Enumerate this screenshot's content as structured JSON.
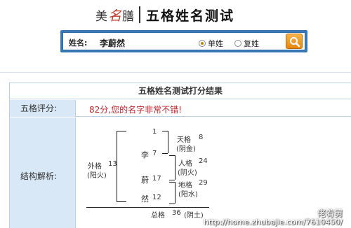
{
  "header": {
    "logo_mei": "美",
    "logo_ming": "名",
    "logo_shan": "膳",
    "page_title": "五格姓名测试"
  },
  "search": {
    "name_label": "姓名:",
    "name_value": "李蔚然",
    "radio_single": "单姓",
    "radio_double": "复姓",
    "selected": "单姓"
  },
  "result": {
    "title": "五格姓名测试打分结果",
    "score_label": "五格评分:",
    "score_text": "82分,您的名字非常不错!",
    "analysis_label": "结构解析:",
    "chars": [
      {
        "char": "",
        "num": "1"
      },
      {
        "char": "李",
        "num": "7"
      },
      {
        "char": "蔚",
        "num": "17"
      },
      {
        "char": "然",
        "num": "12"
      }
    ],
    "tian": {
      "label": "天格",
      "num": "8",
      "element": "(阴金)"
    },
    "ren": {
      "label": "人格",
      "num": "24",
      "element": "(阴火)"
    },
    "di": {
      "label": "地格",
      "num": "29",
      "element": "(阳水)"
    },
    "wai": {
      "label": "外格",
      "num": "13",
      "element": "(阳火)"
    },
    "zong": {
      "label": "总格",
      "num": "36",
      "element": "(阴土)"
    }
  },
  "watermark": {
    "line1": "佬肴舅",
    "line2": "http://home.zhubajie.com/7610450/"
  },
  "colors": {
    "search_bar": "#3a78b6",
    "label_cell": "#d9e8f6",
    "score_text": "#c0262e",
    "border": "#b9cfe4",
    "search_button": "#f0a030"
  }
}
